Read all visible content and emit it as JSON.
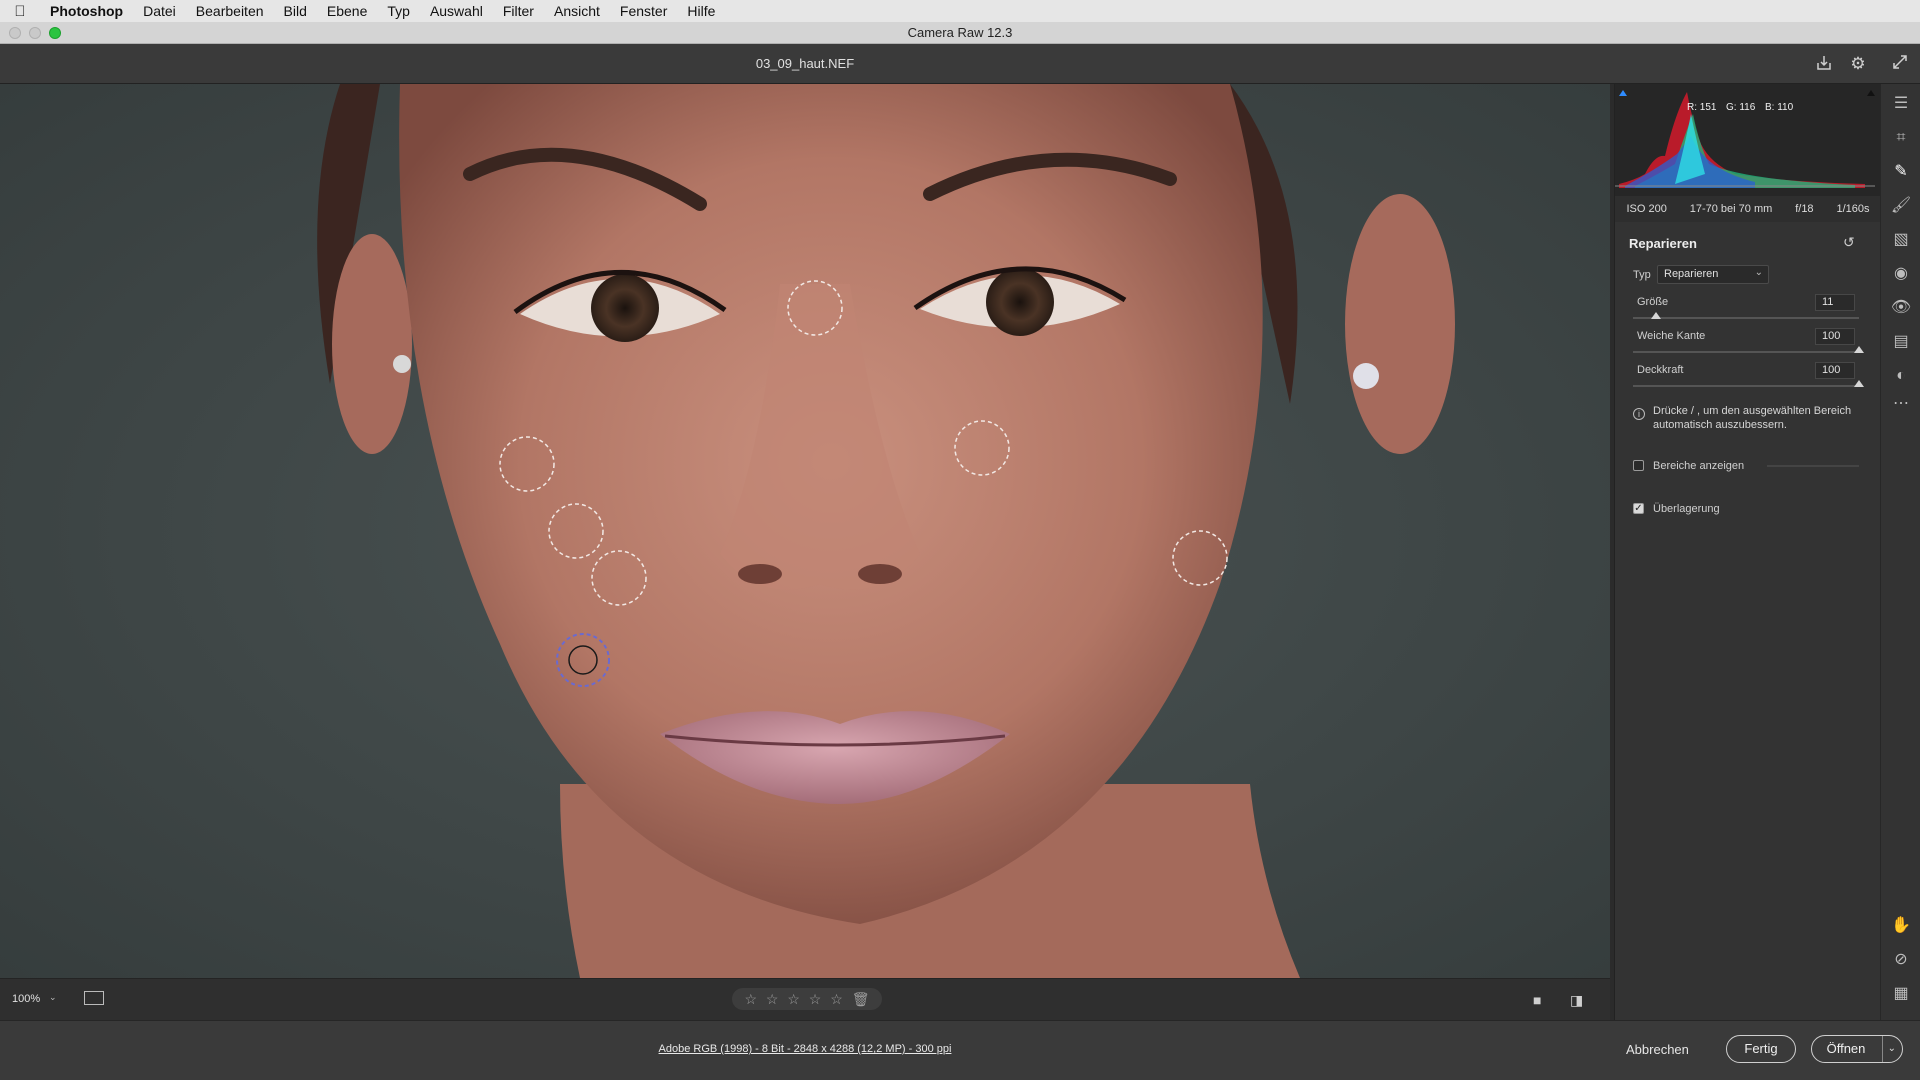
{
  "menubar": {
    "app": "Photoshop",
    "items": [
      "Datei",
      "Bearbeiten",
      "Bild",
      "Ebene",
      "Typ",
      "Auswahl",
      "Filter",
      "Ansicht",
      "Fenster",
      "Hilfe"
    ]
  },
  "window": {
    "title": "Camera Raw 12.3"
  },
  "file": {
    "name": "03_09_haut.NEF"
  },
  "histogram": {
    "r": "R: 151",
    "g": "G: 116",
    "b": "B: 110"
  },
  "exif": {
    "iso": "ISO 200",
    "lens": "17-70 bei 70 mm",
    "aperture": "f/18",
    "shutter": "1/160s"
  },
  "panel": {
    "title": "Reparieren",
    "type_label": "Typ",
    "type_value": "Reparieren",
    "size_label": "Größe",
    "size_value": "11",
    "size_level": 0.1,
    "feather_label": "Weiche Kante",
    "feather_value": "100",
    "feather_level": 1.0,
    "opacity_label": "Deckkraft",
    "opacity_value": "100",
    "opacity_level": 1.0,
    "hint": "Drücke / , um den ausgewählten Bereich automatisch auszubessern.",
    "show_areas_label": "Bereiche anzeigen",
    "show_areas_checked": false,
    "overlay_label": "Überlagerung",
    "overlay_checked": true
  },
  "bottom": {
    "zoom": "100%"
  },
  "footer": {
    "workflow": "Adobe RGB (1998) - 8 Bit - 2848 x 4288 (12,2 MP) - 300 ppi",
    "cancel": "Abbrechen",
    "done": "Fertig",
    "open": "Öffnen"
  }
}
